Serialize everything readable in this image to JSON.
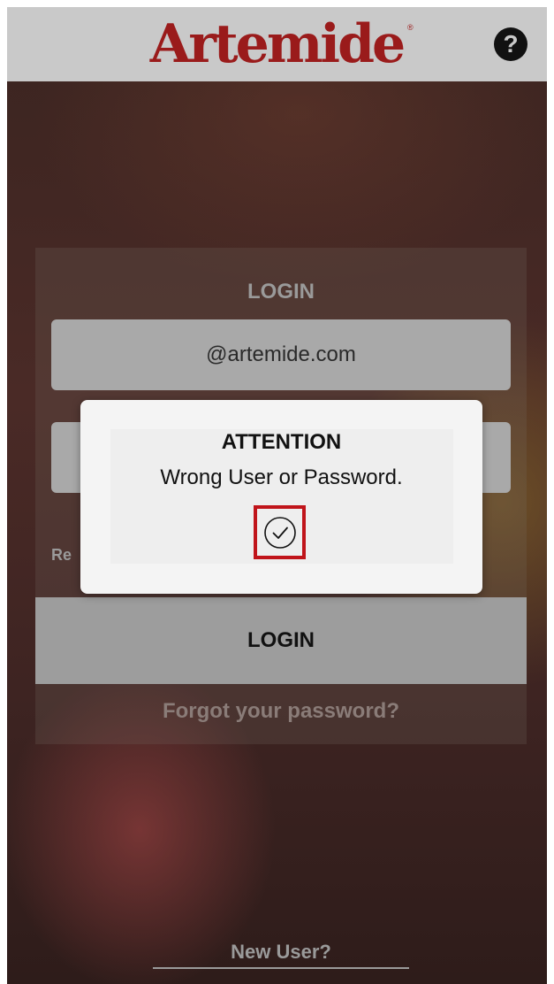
{
  "header": {
    "brand": "Artemide",
    "brand_mark": "®",
    "help_icon": "question-circle-icon",
    "help_glyph": "?"
  },
  "login_form": {
    "title": "LOGIN",
    "email_value": "@artemide.com",
    "password_value": "",
    "remember_label": "Re",
    "login_button": "LOGIN",
    "forgot_link": "Forgot your password?"
  },
  "new_user_link": "New User?",
  "alert": {
    "title": "ATTENTION",
    "message": "Wrong User or Password.",
    "confirm_icon": "check-circle-icon"
  },
  "colors": {
    "brand_red": "#9a1b1b",
    "highlight_red": "#c0141a",
    "header_bg": "#c9c9c9"
  }
}
